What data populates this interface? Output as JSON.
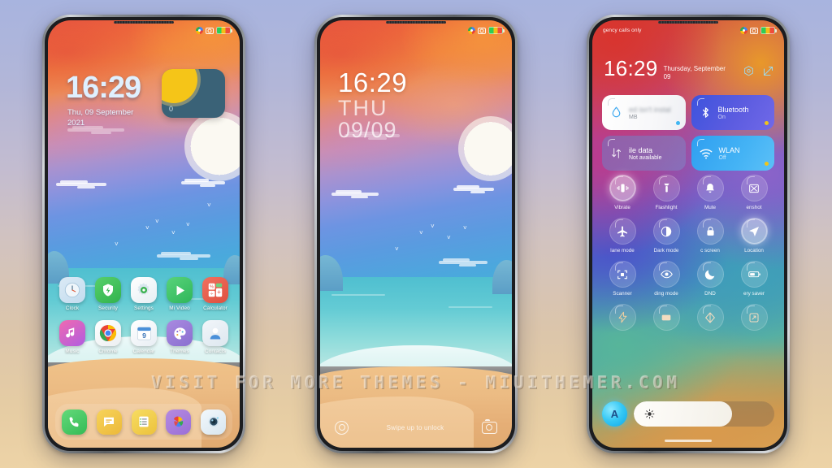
{
  "watermark": "VISIT FOR MORE THEMES - MIUITHEMER.COM",
  "status_bar": {
    "icons": [
      "chrome-icon",
      "screenshot-icon",
      "battery-icon"
    ],
    "emergency_text": "gency calls only"
  },
  "phone1": {
    "name": "home-screen",
    "clock": "16:29",
    "date_line1": "Thu, 09 September",
    "date_line2": "2021",
    "widget": {
      "value": "0",
      "icon": "sun-icon"
    },
    "apps_row1": [
      {
        "label": "Clock",
        "icon": "clock-icon"
      },
      {
        "label": "Security",
        "icon": "shield-icon"
      },
      {
        "label": "Settings",
        "icon": "gear-icon"
      },
      {
        "label": "Mi Video",
        "icon": "play-icon"
      },
      {
        "label": "Calculator",
        "icon": "calculator-icon"
      }
    ],
    "apps_row2": [
      {
        "label": "Music",
        "icon": "music-note-icon"
      },
      {
        "label": "Chrome",
        "icon": "chrome-icon"
      },
      {
        "label": "Calendar",
        "icon": "calendar-icon"
      },
      {
        "label": "Themes",
        "icon": "palette-icon"
      },
      {
        "label": "Contacts",
        "icon": "person-icon"
      }
    ],
    "dock": [
      {
        "label": "Phone",
        "icon": "phone-icon"
      },
      {
        "label": "Messages",
        "icon": "message-icon"
      },
      {
        "label": "Notes",
        "icon": "notes-icon"
      },
      {
        "label": "Gallery",
        "icon": "gallery-icon"
      },
      {
        "label": "Camera",
        "icon": "camera-icon"
      }
    ],
    "calendar_day": "9"
  },
  "phone2": {
    "name": "lock-screen",
    "clock": "16:29",
    "weekday": "THU",
    "date": "09/09",
    "swipe_hint": "Swipe up to unlock",
    "left_icon": "flashlight-icon",
    "right_icon": "camera-icon"
  },
  "phone3": {
    "name": "notification-panel",
    "clock": "16:29",
    "date": "Thursday, September 09",
    "actions": [
      {
        "name": "settings-gear-icon"
      },
      {
        "name": "edit-icon"
      }
    ],
    "cards": [
      {
        "title": "ed isn't instal",
        "subtitle": "MB",
        "icon": "water-drop-icon",
        "style": "white",
        "dot": "#3fb6f2"
      },
      {
        "title": "Bluetooth",
        "subtitle": "On",
        "icon": "bluetooth-icon",
        "style": "bt",
        "dot": "#f0c419"
      },
      {
        "title": "ile data",
        "subtitle": "Not available",
        "icon": "data-arrows-icon",
        "style": "data",
        "dot": ""
      },
      {
        "title": "WLAN",
        "subtitle": "Off",
        "icon": "wifi-icon",
        "style": "wlan",
        "dot": "#f0c419"
      }
    ],
    "toggles": [
      {
        "label": "Vibrate",
        "icon": "vibrate-icon",
        "state": "on"
      },
      {
        "label": "Flashlight",
        "icon": "flashlight-icon",
        "state": "off"
      },
      {
        "label": "Mute",
        "icon": "bell-icon",
        "state": "off"
      },
      {
        "label": "enshot",
        "icon": "screenshot-icon",
        "state": "off"
      },
      {
        "label": "lane mode",
        "icon": "airplane-icon",
        "state": "off"
      },
      {
        "label": "Dark mode",
        "icon": "contrast-icon",
        "state": "off"
      },
      {
        "label": "c screen",
        "icon": "lock-icon",
        "state": "off"
      },
      {
        "label": "Location",
        "icon": "location-icon",
        "state": "on"
      },
      {
        "label": "Scanner",
        "icon": "scan-icon",
        "state": "off"
      },
      {
        "label": "ding mode",
        "icon": "eye-icon",
        "state": "off"
      },
      {
        "label": "DND",
        "icon": "moon-icon",
        "state": "off"
      },
      {
        "label": "ery saver",
        "icon": "battery-icon",
        "state": "off"
      },
      {
        "label": "",
        "icon": "bolt-icon",
        "state": "dim"
      },
      {
        "label": "",
        "icon": "cast-icon",
        "state": "dim"
      },
      {
        "label": "",
        "icon": "reading-icon",
        "state": "dim"
      },
      {
        "label": "",
        "icon": "rotate-icon",
        "state": "dim"
      }
    ],
    "brightness": {
      "auto_label": "A",
      "level": 70,
      "icon": "brightness-icon"
    }
  },
  "colors": {
    "accent_blue": "#3fb6f2",
    "bluetooth": "#4a5ae0",
    "wlan": "#3aa8f2",
    "sun_yellow": "#f5c518",
    "widget_teal": "#3a6277"
  }
}
